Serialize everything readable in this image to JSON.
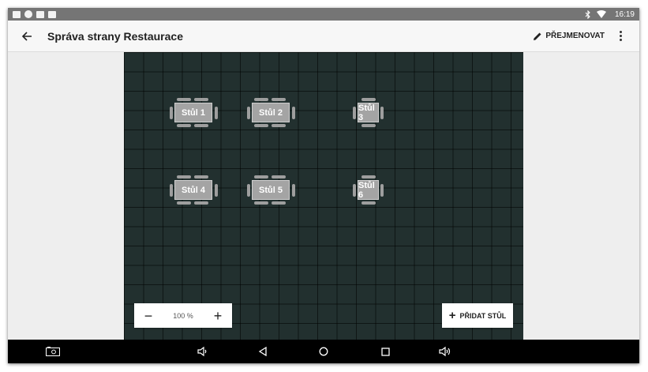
{
  "status_bar": {
    "time": "16:19",
    "left_icons": [
      "image-icon",
      "accessibility-icon",
      "mail-icon",
      "screen-icon"
    ],
    "right_icons": [
      "bluetooth-icon",
      "wifi-icon"
    ]
  },
  "app_bar": {
    "title": "Správa strany Restaurace",
    "rename_label": "PŘEJMENOVAT"
  },
  "tables": [
    {
      "label": "Stůl 1",
      "shape": "rect"
    },
    {
      "label": "Stůl 2",
      "shape": "rect"
    },
    {
      "label": "Stůl 3",
      "shape": "square"
    },
    {
      "label": "Stůl 4",
      "shape": "rect"
    },
    {
      "label": "Stůl 5",
      "shape": "rect"
    },
    {
      "label": "Stůl 6",
      "shape": "square"
    }
  ],
  "zoom": {
    "minus_label": "−",
    "level": "100 %",
    "plus_label": "+"
  },
  "add_table": {
    "plus": "+",
    "label": "PŘIDAT STŮL"
  },
  "colors": {
    "canvas_bg": "#22302f",
    "table_fill": "#a4a4a4",
    "status_bar": "#757575",
    "nav_bar": "#000000"
  }
}
